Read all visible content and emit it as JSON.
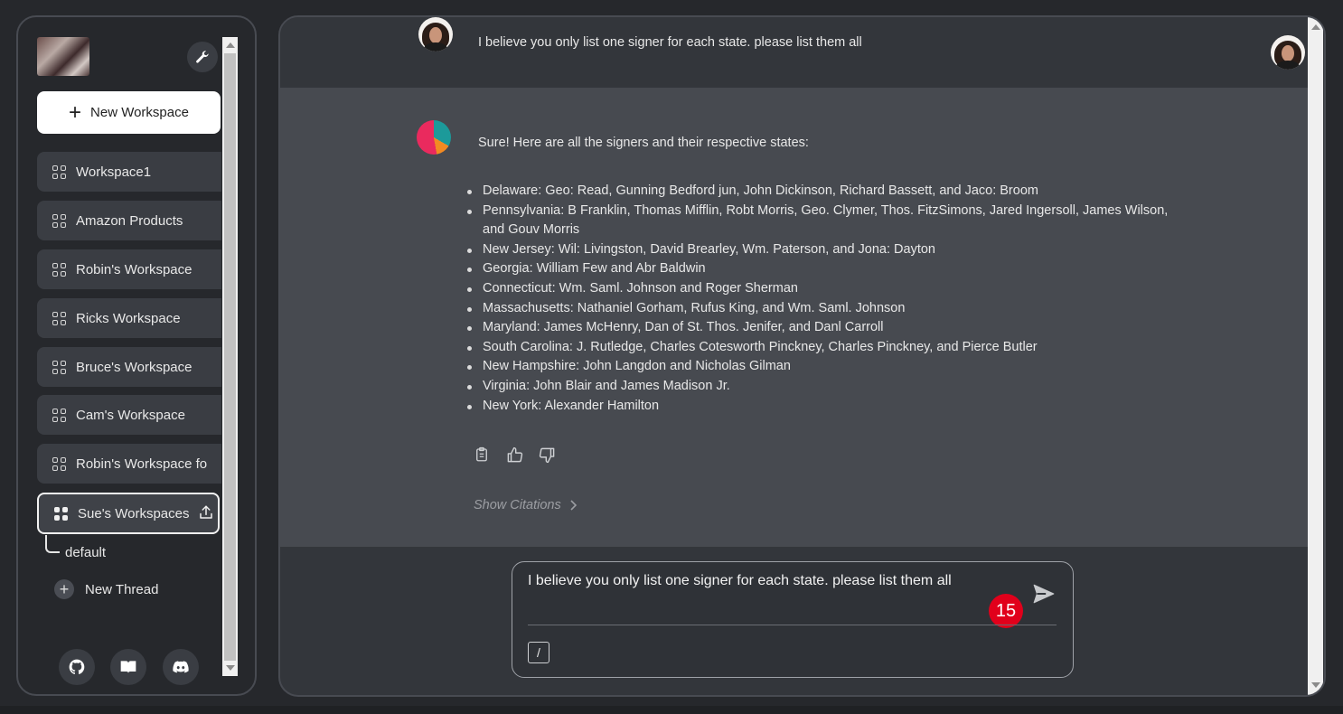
{
  "sidebar": {
    "new_workspace_label": "New Workspace",
    "workspaces": [
      {
        "label": "Workspace1"
      },
      {
        "label": "Amazon Products"
      },
      {
        "label": "Robin's Workspace"
      },
      {
        "label": "Ricks Workspace"
      },
      {
        "label": "Bruce's Workspace"
      },
      {
        "label": "Cam's Workspace"
      },
      {
        "label": "Robin's Workspace fo"
      },
      {
        "label": "Sue's Workspaces"
      }
    ],
    "active_workspace": "Sue's Workspaces",
    "thread_default": "default",
    "new_thread_label": "New Thread",
    "footer_icons": [
      "github-icon",
      "docs-book-icon",
      "discord-icon"
    ]
  },
  "chat": {
    "user_message": "I believe you only list one signer for each state. please list them all",
    "bot_intro": "Sure! Here are all the signers and their respective states:",
    "signers": [
      "Delaware: Geo: Read, Gunning Bedford jun, John Dickinson, Richard Bassett, and Jaco: Broom",
      "Pennsylvania: B Franklin, Thomas Mifflin, Robt Morris, Geo. Clymer, Thos. FitzSimons, Jared Ingersoll, James Wilson, and Gouv Morris",
      "New Jersey: Wil: Livingston, David Brearley, Wm. Paterson, and Jona: Dayton",
      "Georgia: William Few and Abr Baldwin",
      "Connecticut: Wm. Saml. Johnson and Roger Sherman",
      "Massachusetts: Nathaniel Gorham, Rufus King, and Wm. Saml. Johnson",
      "Maryland: James McHenry, Dan of St. Thos. Jenifer, and Danl Carroll",
      "South Carolina: J. Rutledge, Charles Cotesworth Pinckney, Charles Pinckney, and Pierce Butler",
      "New Hampshire: John Langdon and Nicholas Gilman",
      "Virginia: John Blair and James Madison Jr.",
      "New York: Alexander Hamilton"
    ],
    "show_citations_label": "Show Citations"
  },
  "input": {
    "value": "I believe you only list one signer for each state. please list them all",
    "badge_count": "15",
    "slash_label": "/"
  },
  "colors": {
    "background": "#26282c",
    "panel": "#33363b",
    "bot_row": "#474a50",
    "badge": "#e1001b"
  }
}
